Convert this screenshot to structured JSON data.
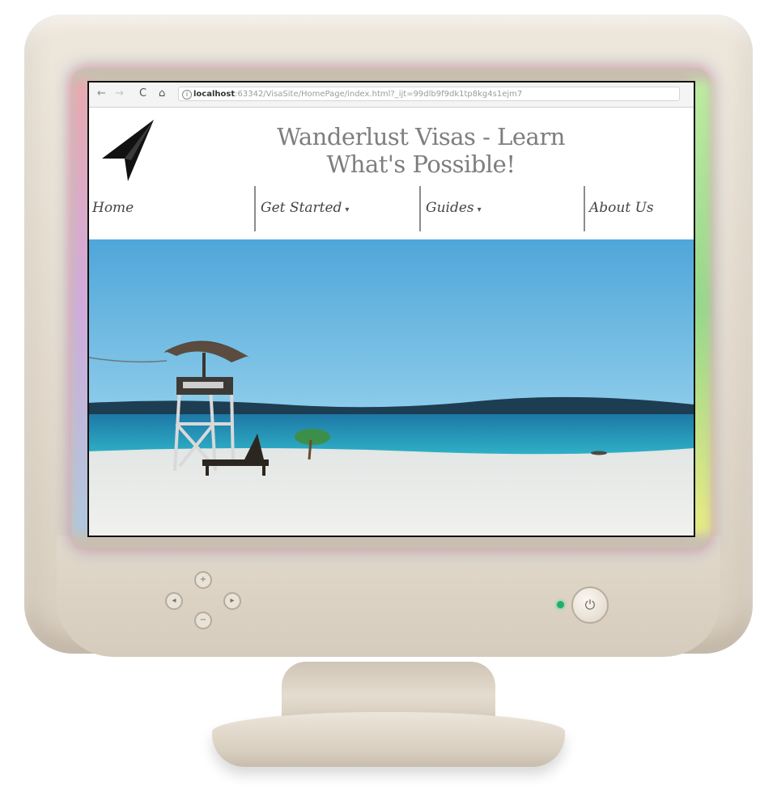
{
  "browser": {
    "nav_back_icon": "arrow-left-icon",
    "nav_forward_icon": "arrow-right-icon",
    "reload_icon": "reload-icon",
    "home_icon": "home-icon",
    "url_host": "localhost",
    "url_rest": ":63342/VisaSite/HomePage/index.html?_ijt=99dlb9f9dk1tp8kg4s1ejm7"
  },
  "site": {
    "title": "Wanderlust Visas - Learn What's Possible!",
    "logo_icon": "paper-plane-icon"
  },
  "nav": {
    "items": [
      {
        "label": "Home",
        "has_dropdown": false
      },
      {
        "label": "Get Started",
        "has_dropdown": true
      },
      {
        "label": "Guides",
        "has_dropdown": true
      },
      {
        "label": "About Us",
        "has_dropdown": false
      }
    ],
    "caret": "▾"
  },
  "hero": {
    "scene": "beach-lifeguard-tower-photo"
  },
  "monitor": {
    "power_symbol": "⏻",
    "led_color": "#1fae6d",
    "bezel_color": "#e3dacd"
  }
}
